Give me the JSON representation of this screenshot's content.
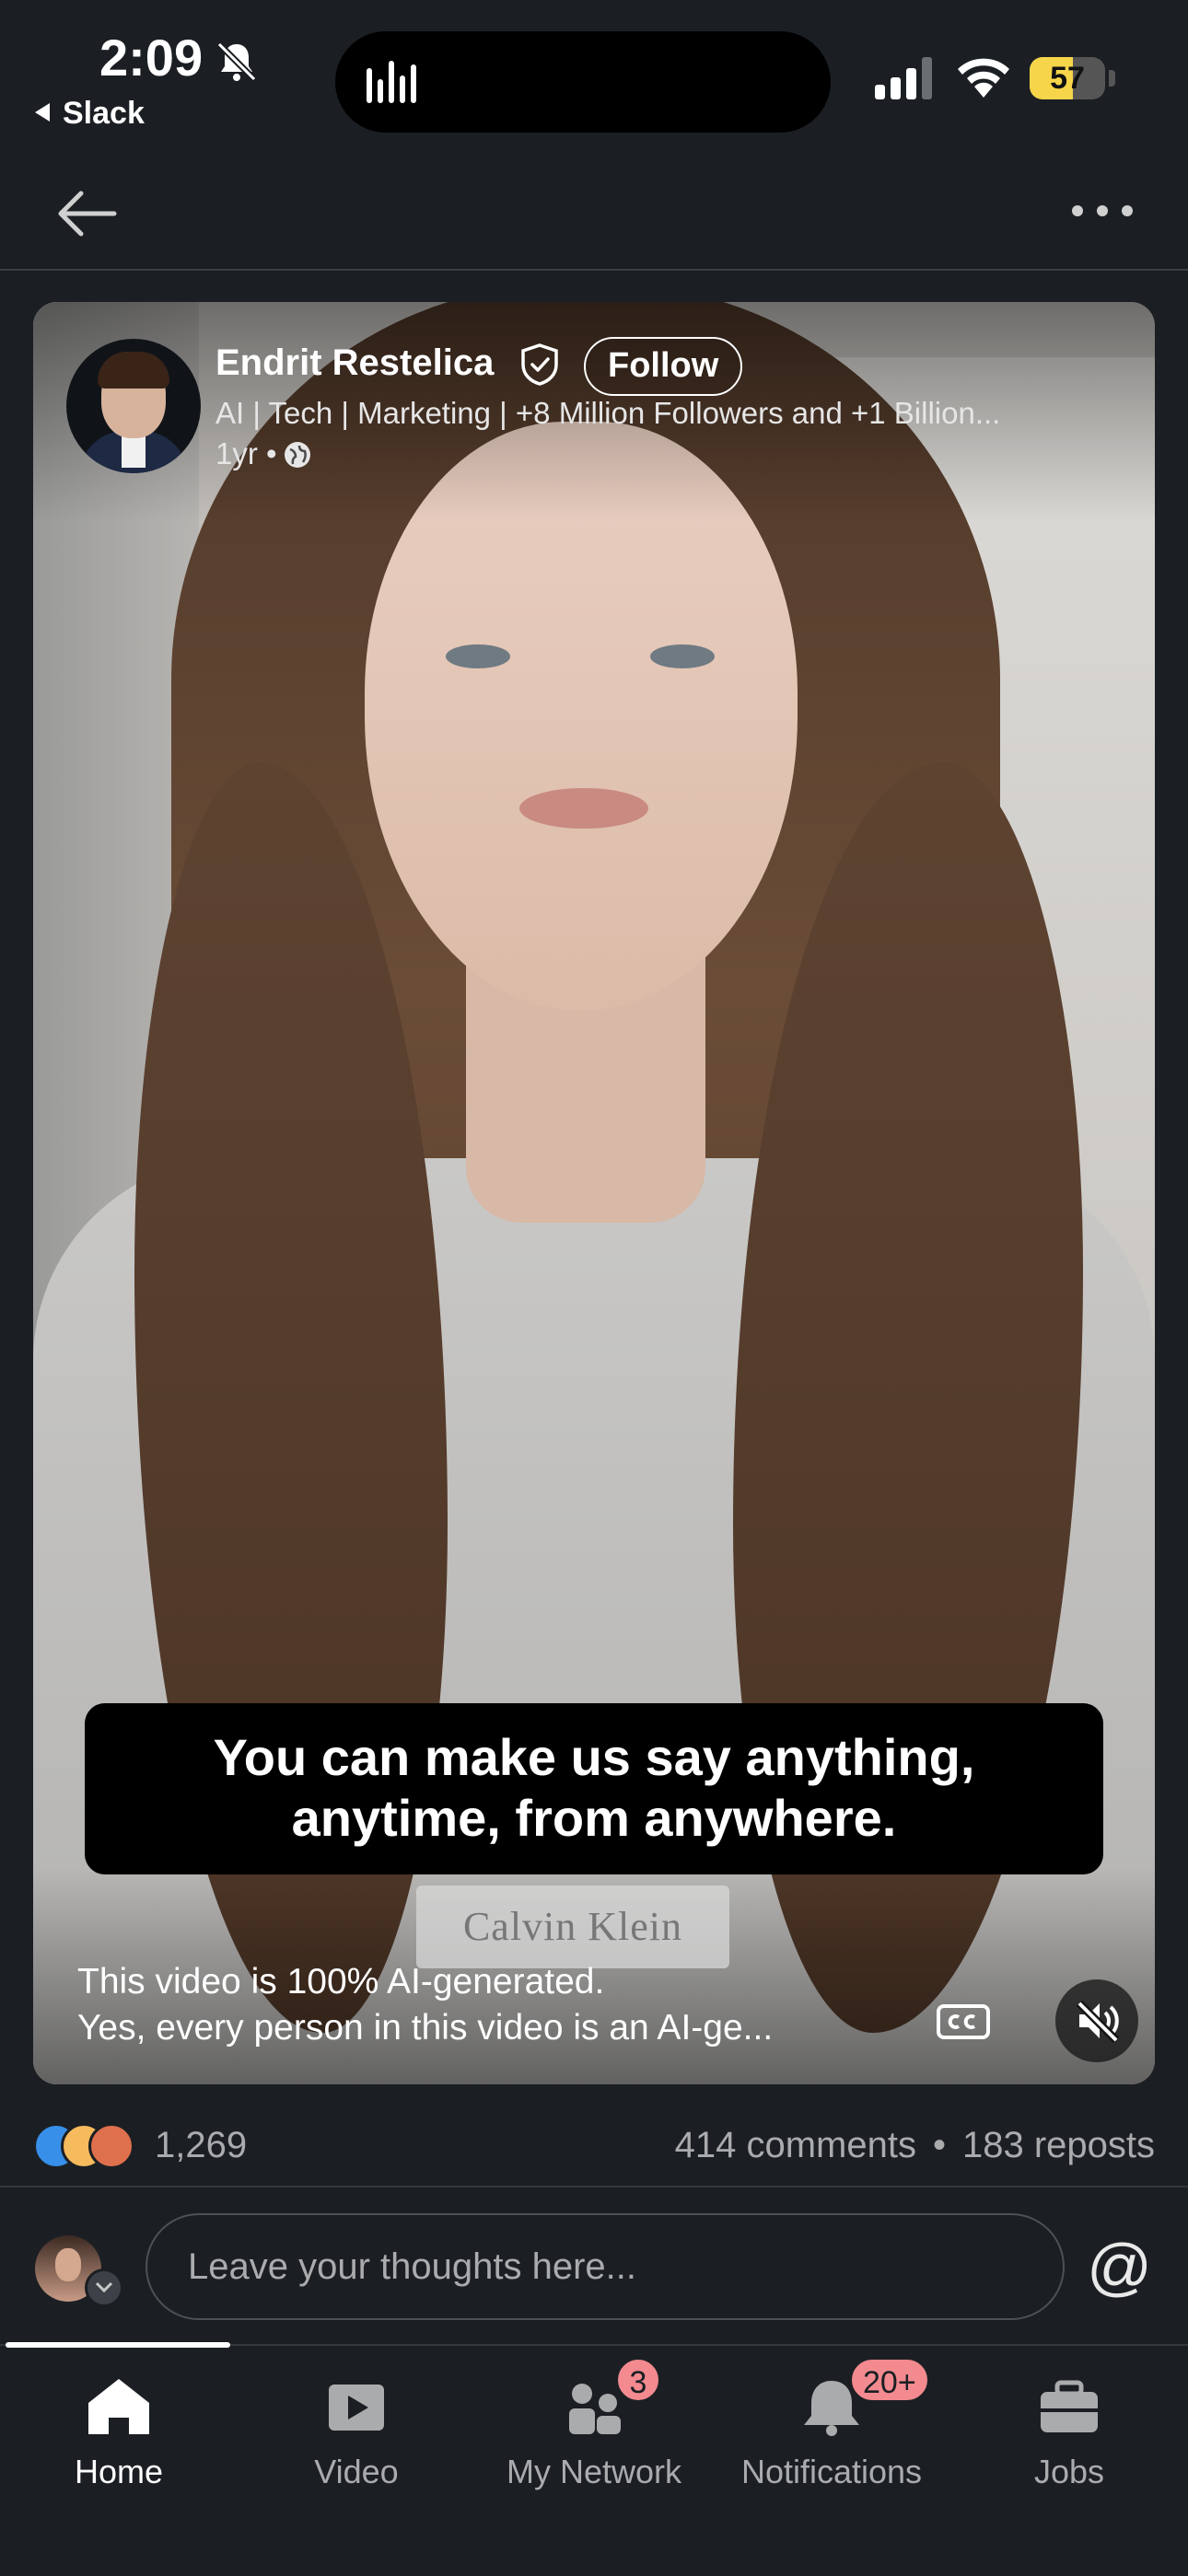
{
  "status_bar": {
    "time": "2:09",
    "back_app": "Slack",
    "battery": "57",
    "battery_level": 0.57
  },
  "post": {
    "author_name": "Endrit Restelica",
    "follow_label": "Follow",
    "headline": "AI | Tech | Marketing | +8 Million Followers and +1 Billion...",
    "age": "1yr",
    "visibility_separator": "•",
    "caption_line1": "You can make us say anything,",
    "caption_line2": "anytime, from anywhere.",
    "brand_text": "Calvin Klein",
    "description_line1": "This video is 100% AI-generated.",
    "description_line2": "Yes, every person in this video is an AI-ge..."
  },
  "social": {
    "reaction_count": "1,269",
    "comments": "414 comments",
    "separator": "•",
    "reposts": "183 reposts"
  },
  "comment_box": {
    "placeholder": "Leave your thoughts here...",
    "mention_symbol": "@"
  },
  "tabs": [
    {
      "label": "Home",
      "icon": "home-icon",
      "active": true
    },
    {
      "label": "Video",
      "icon": "video-icon"
    },
    {
      "label": "My Network",
      "icon": "network-icon",
      "badge": "3"
    },
    {
      "label": "Notifications",
      "icon": "bell-icon",
      "badge": "20+"
    },
    {
      "label": "Jobs",
      "icon": "briefcase-icon"
    }
  ],
  "colors": {
    "background": "#1b1f23",
    "badge": "#f38a8f",
    "battery": "#f7d54a",
    "like": "#378fe9"
  }
}
